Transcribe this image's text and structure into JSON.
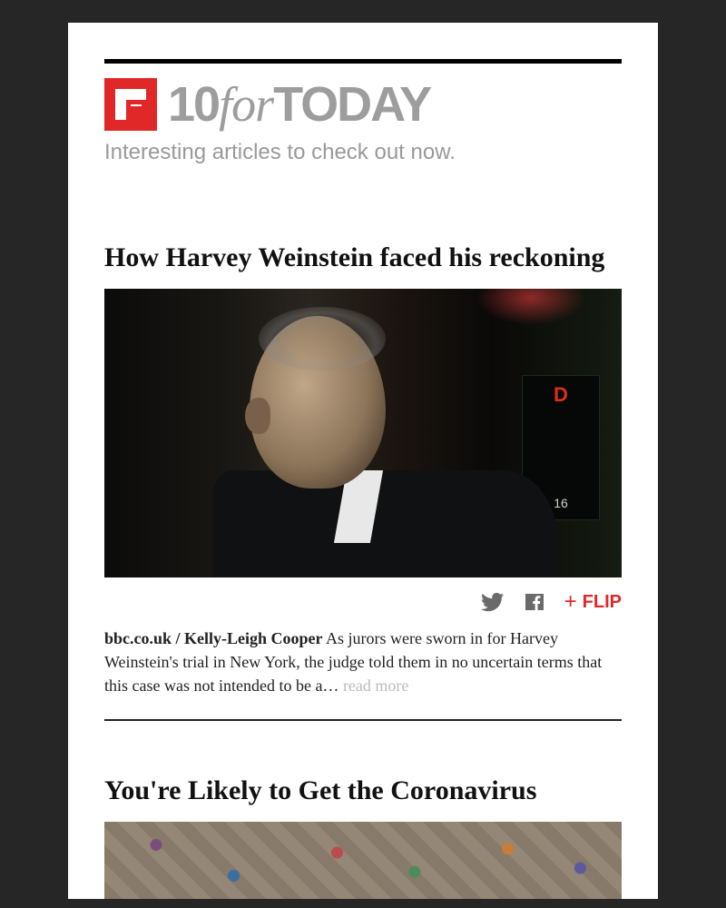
{
  "brand": {
    "ten": "10",
    "for": "for",
    "today": "TODAY",
    "tagline": "Interesting articles to check out now."
  },
  "actions": {
    "flip_label": "FLIP"
  },
  "articles": [
    {
      "title": "How Harvey Weinstein faced his reckoning",
      "source": "bbc.co.uk / Kelly-Leigh Cooper",
      "excerpt": " As jurors were sworn in for Harvey Weinstein's trial in New York, the judge told them in no uncertain terms that this case was not intended to be a… ",
      "read_more": "read more"
    },
    {
      "title": "You're Likely to Get the Coronavirus"
    }
  ]
}
